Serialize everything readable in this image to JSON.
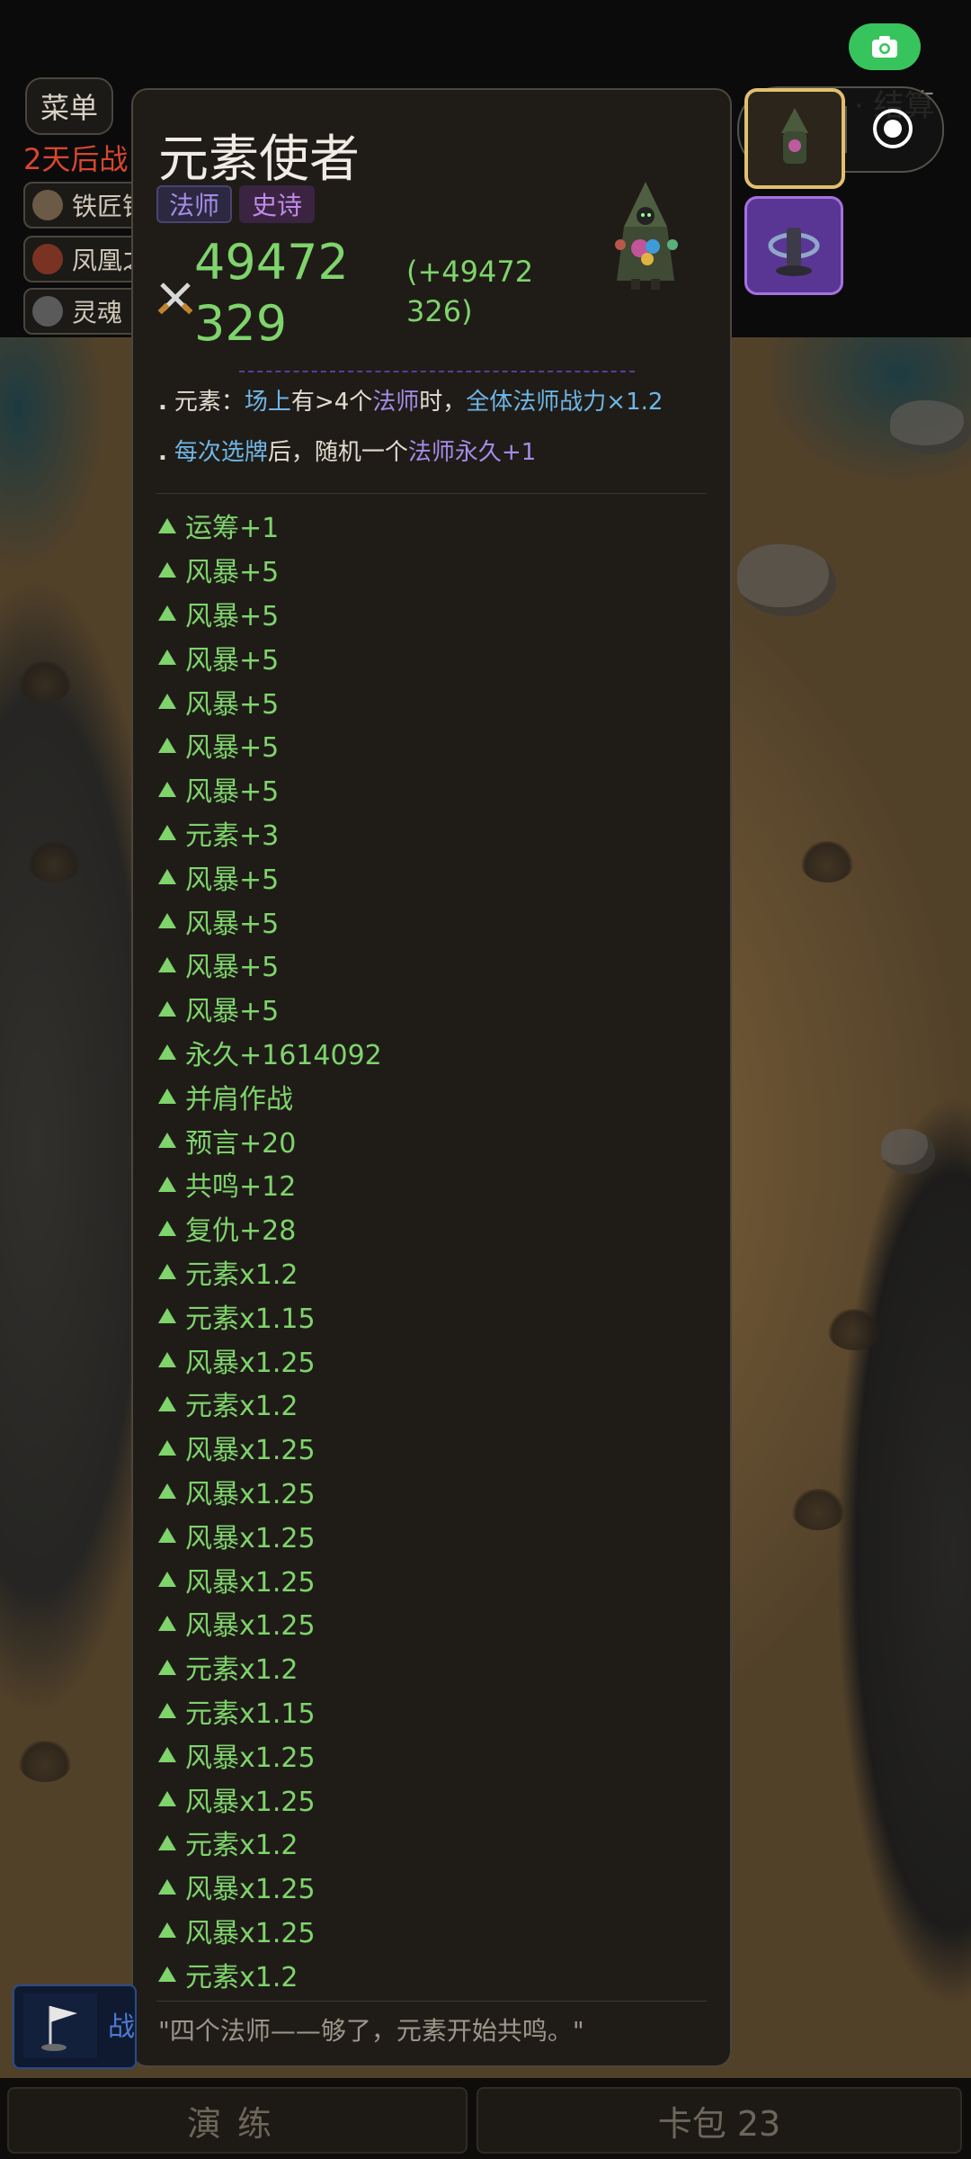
{
  "hud": {
    "menu_label": "菜单",
    "top_right_partial": "· 结算",
    "countdown_partial": "2天后战",
    "chips": [
      {
        "label": "铁匠铺",
        "icon": "blacksmith-icon"
      },
      {
        "label": "凤凰之",
        "icon": "phoenix-icon"
      },
      {
        "label": "灵魂",
        "icon": "soul-icon"
      }
    ]
  },
  "card": {
    "name": "元素使者",
    "class_tag": "法师",
    "rarity_tag": "史诗",
    "power": "49472329",
    "power_delta": "(+49472326)",
    "abilities": [
      {
        "segments": [
          {
            "text": "元素：",
            "style": "plain"
          },
          {
            "text": "场上",
            "style": "blue"
          },
          {
            "text": "有>4个",
            "style": "plain"
          },
          {
            "text": "法师",
            "style": "purple"
          },
          {
            "text": "时，",
            "style": "plain"
          },
          {
            "text": "全体法师战力×1.2",
            "style": "blue"
          }
        ]
      },
      {
        "segments": [
          {
            "text": "每次选牌",
            "style": "blue"
          },
          {
            "text": "后，随机一个",
            "style": "plain"
          },
          {
            "text": "法师永久+1",
            "style": "purple"
          }
        ]
      }
    ],
    "buffs": [
      "运筹+1",
      "风暴+5",
      "风暴+5",
      "风暴+5",
      "风暴+5",
      "风暴+5",
      "风暴+5",
      "元素+3",
      "风暴+5",
      "风暴+5",
      "风暴+5",
      "风暴+5",
      "永久+1614092",
      "并肩作战",
      "预言+20",
      "共鸣+12",
      "复仇+28",
      "元素x1.2",
      "元素x1.15",
      "风暴x1.25",
      "元素x1.2",
      "风暴x1.25",
      "风暴x1.25",
      "风暴x1.25",
      "风暴x1.25",
      "风暴x1.25",
      "元素x1.2",
      "元素x1.15",
      "风暴x1.25",
      "风暴x1.25",
      "元素x1.2",
      "风暴x1.25",
      "风暴x1.25",
      "元素x1.2"
    ],
    "quote": "\"四个法师——够了，元素开始共鸣。\""
  },
  "bottom": {
    "left_widget_partial": "战",
    "practice_label": "演练",
    "pack_label": "卡包 23"
  },
  "colors": {
    "power_green": "#7fd46b",
    "keyword_blue": "#6fb6e6",
    "keyword_purple": "#a58ce8",
    "camera_green": "#37c45d",
    "countdown_red": "#d8462f"
  }
}
